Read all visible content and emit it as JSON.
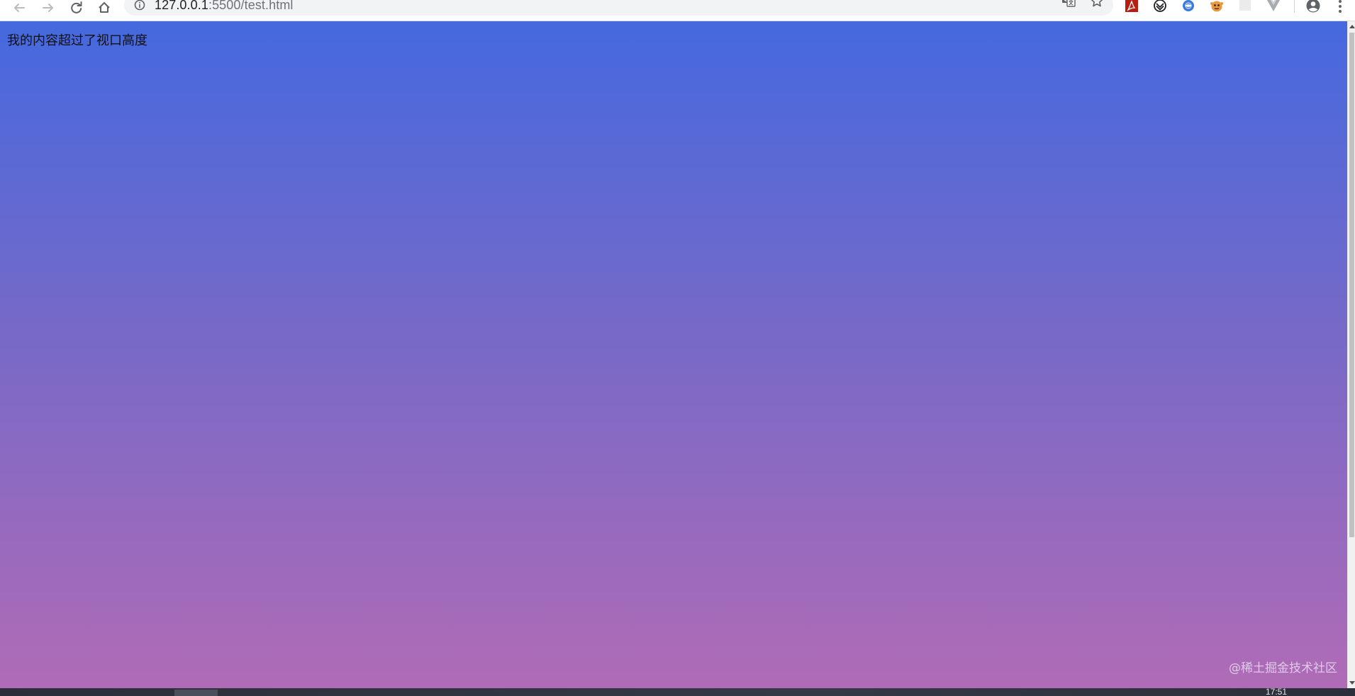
{
  "browser": {
    "url_host": "127.0.0.1",
    "url_rest": ":5500/test.html"
  },
  "toolbar": {
    "icons": [
      "back-arrow-icon",
      "forward-arrow-icon",
      "reload-icon",
      "home-icon",
      "site-info-icon",
      "translate-icon",
      "bookmark-star-icon"
    ],
    "extensions": [
      "acrobat-extension-icon",
      "wappalyzer-extension-icon",
      "chrome-extension-blue-icon",
      "tampermonkey-extension-icon",
      "blank-extension-icon",
      "vue-devtools-extension-icon"
    ],
    "trailing": [
      "profile-avatar-icon",
      "menu-kebab-icon"
    ]
  },
  "page": {
    "text": "我的内容超过了视口高度",
    "background_top": "#4569df",
    "background_bottom": "#b06bb6"
  },
  "watermark": {
    "text": "@稀土掘金技术社区"
  },
  "taskbar": {
    "clock": "17:51"
  }
}
